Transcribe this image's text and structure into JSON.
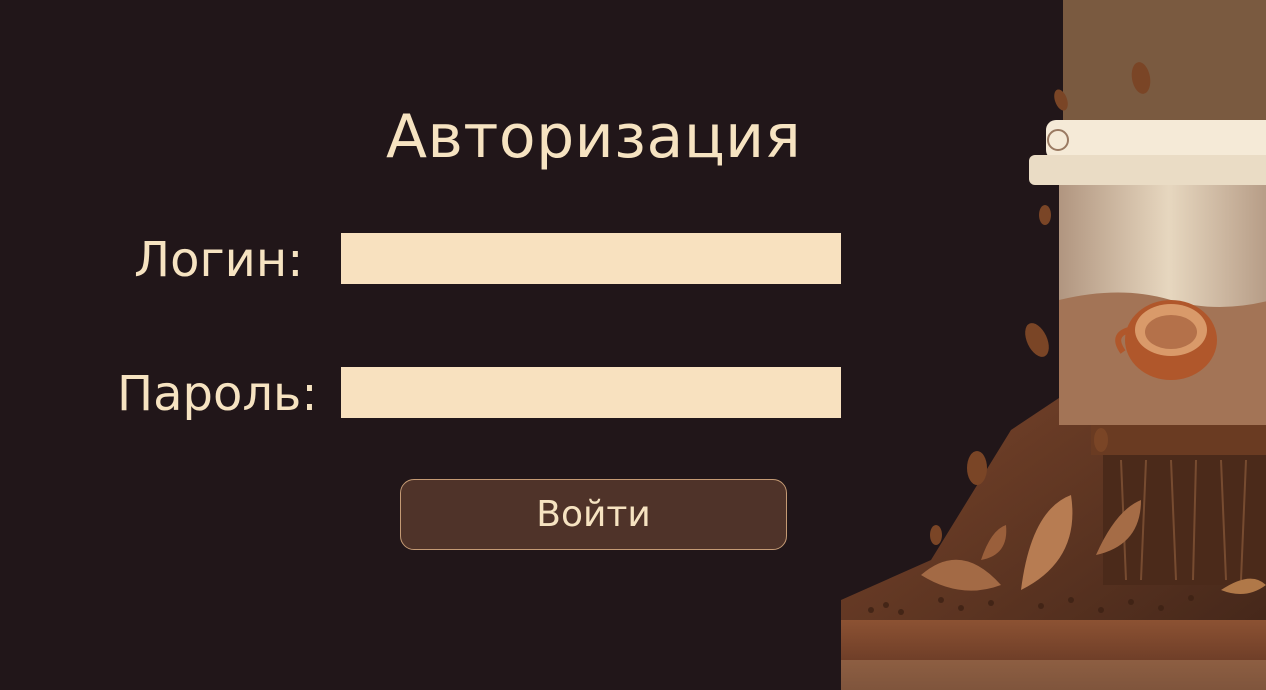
{
  "form": {
    "title": "Авторизация",
    "login_label": "Логин:",
    "login_value": "",
    "password_label": "Пароль:",
    "password_value": "",
    "submit_label": "Войти"
  },
  "colors": {
    "background": "#211619",
    "text": "#f6e3c1",
    "field": "#f8e1bf",
    "button": "#4f3329",
    "button_border": "#c49a74"
  },
  "illustration": {
    "icon": "coffee-machine-illustration"
  }
}
